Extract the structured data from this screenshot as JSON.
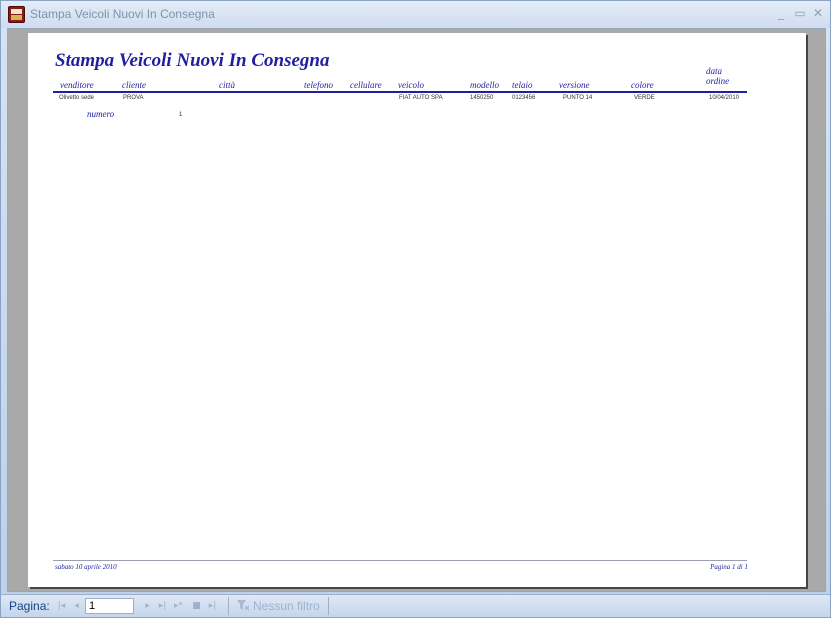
{
  "window": {
    "title": "Stampa Veicoli Nuovi In Consegna"
  },
  "report": {
    "title": "Stampa Veicoli Nuovi In Consegna",
    "headers": {
      "venditore": "venditore",
      "cliente": "cliente",
      "citta": "città",
      "telefono": "telefono",
      "cellulare": "cellulare",
      "veicolo": "veicolo",
      "modello": "modello",
      "telaio": "telaio",
      "versione": "versione",
      "colore": "colore",
      "data": "data",
      "ordine": "ordine"
    },
    "row": {
      "venditore": "Olivetto sede",
      "cliente": "PROVA",
      "veicolo": "FIAT AUTO SPA",
      "modello": "1450250",
      "telaio": "0123456",
      "versione": "PUNTO 14",
      "colore": "VERDE",
      "data_ordine": "10/04/2010"
    },
    "numero_label": "numero",
    "numero_value": "1",
    "footer_date": "sabato 10 aprile 2010",
    "footer_page": "Pagina 1 di 1"
  },
  "navigation": {
    "label": "Pagina:",
    "current_page": "1",
    "filter_label": "Nessun filtro"
  }
}
